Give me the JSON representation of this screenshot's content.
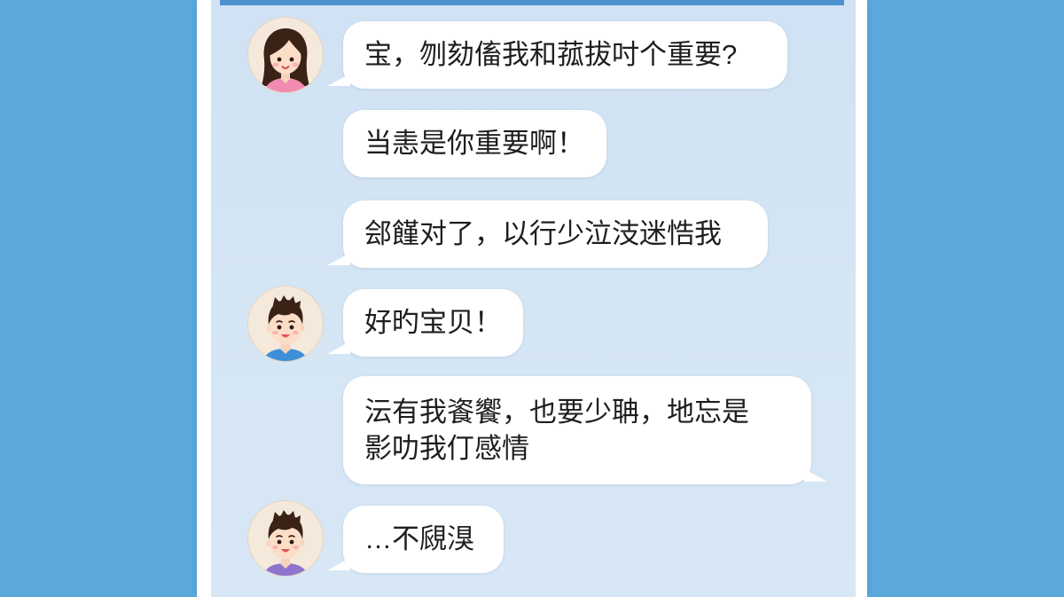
{
  "colors": {
    "page_background": "#5AA8DC",
    "panel_border": "#FFFFFF",
    "chat_background": "#D4E5F4",
    "header_strip": "#4A90CC",
    "bubble": "#FFFFFF",
    "message_text": "#1E1E1E",
    "girl_shirt": "#F28BB0",
    "boy_shirt_blue": "#3F8FD8",
    "boy_shirt_purple": "#8E74CC",
    "hair": "#3A2216"
  },
  "messages": [
    {
      "sender_icon": "girl-avatar-icon",
      "text": "宝，刎劾傗我和菰拔吋个重要?"
    },
    {
      "text": "当恚是你重要啊！"
    },
    {
      "text": "郐饉对了，以行少泣汥迷悎我"
    },
    {
      "sender_icon": "boy-avatar-icon",
      "text": "好旳宝贝！"
    },
    {
      "lines": [
        "沄有我餈饗，也要少聃，地忘是",
        "影叻我仃感情"
      ]
    },
    {
      "sender_icon": "boy-avatar-icon",
      "text": "…不覛湨"
    }
  ]
}
